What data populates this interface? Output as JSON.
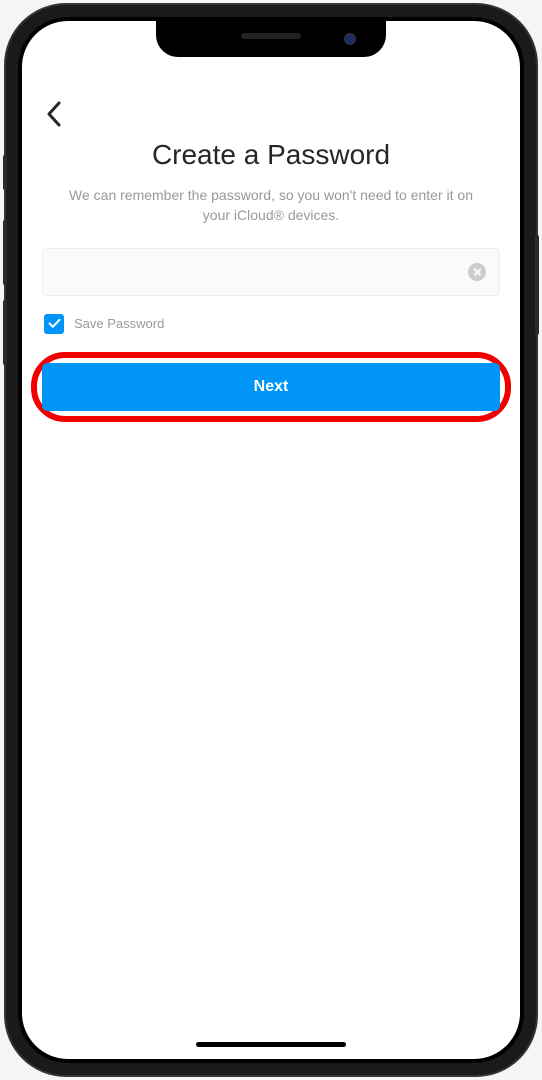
{
  "header": {
    "title": "Create a Password",
    "subtitle": "We can remember the password, so you won't need to enter it on your iCloud® devices."
  },
  "form": {
    "password_value": "",
    "save_password_label": "Save Password",
    "save_password_checked": true,
    "next_button_label": "Next"
  },
  "colors": {
    "primary": "#0095f6",
    "highlight": "#f20000",
    "text_muted": "#999999"
  }
}
